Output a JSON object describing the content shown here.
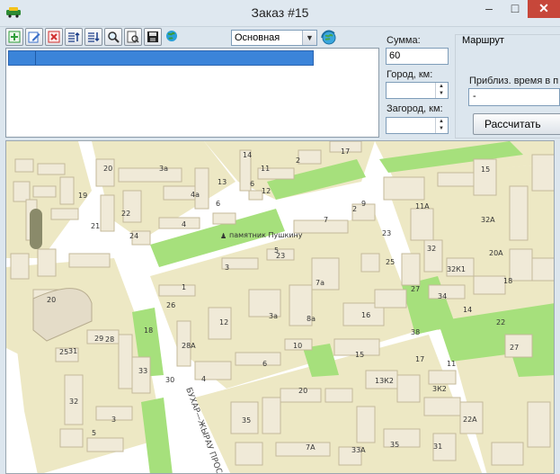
{
  "window": {
    "title": "Заказ #15",
    "controls": {
      "minimize": "–",
      "maximize": "□",
      "close": "✕"
    }
  },
  "toolbar": {
    "buttons": [
      {
        "icon": "add-icon",
        "color": "#2f9e3a"
      },
      {
        "icon": "edit-icon",
        "color": "#3a6fc8"
      },
      {
        "icon": "delete-icon",
        "color": "#d03030"
      },
      {
        "icon": "sort-up-icon",
        "color": "#1d3f8a"
      },
      {
        "icon": "sort-down-icon",
        "color": "#1d3f8a"
      },
      {
        "icon": "search-icon",
        "color": "#333333"
      },
      {
        "icon": "preview-icon",
        "color": "#333333"
      },
      {
        "icon": "save-icon",
        "color": "#222222"
      },
      {
        "icon": "globe-icon",
        "color": "#1a7fb5"
      }
    ],
    "route_select": {
      "value": "Основная"
    },
    "refresh_icon": "refresh-globe-icon"
  },
  "order_form": {
    "sum_label": "Сумма:",
    "sum_value": "60",
    "city_km_label": "Город, км:",
    "city_km_value": "",
    "suburb_km_label": "Загород, км:",
    "suburb_km_value": ""
  },
  "route": {
    "group_title": "Маршрут",
    "eta_label": "Приблиз. время в п",
    "eta_value": "-",
    "calculate_label": "Рассчитать"
  },
  "map": {
    "colors": {
      "ground": "#ffffff",
      "block": "#ede8c4",
      "building": "#f0ead8",
      "building_edge": "#c4b99a",
      "park": "#a6e07c",
      "road": "#ffffff"
    },
    "landmark": "памятник Пушкину",
    "street": "БУХАР—ЖЫРАУ ПРОС",
    "labels": [
      "20",
      "3а",
      "19",
      "4а",
      "13",
      "14",
      "6",
      "12",
      "22",
      "11",
      "21",
      "24",
      "4",
      "2",
      "6",
      "23",
      "2",
      "7",
      "9",
      "11А",
      "32",
      "32А",
      "23",
      "15",
      "17",
      "3",
      "5",
      "7а",
      "25",
      "32К1",
      "20А",
      "1",
      "26",
      "3а",
      "8а",
      "27",
      "34",
      "18",
      "22",
      "20",
      "25",
      "28",
      "28А",
      "12",
      "16",
      "14",
      "38",
      "27",
      "29",
      "18",
      "31",
      "33",
      "30",
      "4",
      "6",
      "10",
      "15",
      "17",
      "11",
      "13К2",
      "3К2",
      "20",
      "32",
      "35",
      "22А",
      "3",
      "5",
      "7А",
      "33А",
      "35",
      "31"
    ]
  }
}
